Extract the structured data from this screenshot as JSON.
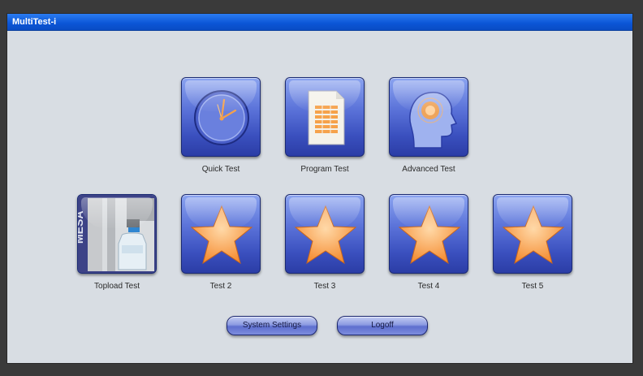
{
  "window": {
    "title": "MultiTest-i"
  },
  "tiles_row1": [
    {
      "label": "Quick Test",
      "icon": "clock-icon"
    },
    {
      "label": "Program Test",
      "icon": "spreadsheet-document-icon"
    },
    {
      "label": "Advanced Test",
      "icon": "head-profile-icon"
    }
  ],
  "tiles_row2": [
    {
      "label": "Topload Test",
      "icon": "topload-photo-icon"
    },
    {
      "label": "Test 2",
      "icon": "star-icon"
    },
    {
      "label": "Test 3",
      "icon": "star-icon"
    },
    {
      "label": "Test 4",
      "icon": "star-icon"
    },
    {
      "label": "Test 5",
      "icon": "star-icon"
    }
  ],
  "buttons": {
    "system_settings": "System Settings",
    "logoff": "Logoff"
  },
  "colors": {
    "titlebar": "#0b55d6",
    "tile_blue": "#3a4fbe",
    "star_orange": "#f6a24a",
    "background": "#d8dde3"
  }
}
